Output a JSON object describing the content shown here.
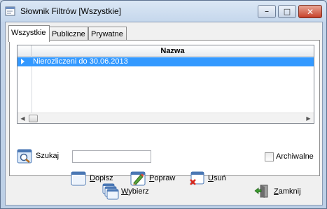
{
  "window": {
    "title": "Słownik Filtrów [Wszystkie]",
    "minimize_label": "–",
    "maximize_label": "□",
    "close_label": "✕"
  },
  "tabs": [
    {
      "label": "Wszystkie",
      "active": true
    },
    {
      "label": "Publiczne",
      "active": false
    },
    {
      "label": "Prywatne",
      "active": false
    }
  ],
  "grid": {
    "column_header": "Nazwa",
    "rows": [
      {
        "name": "Nierozliczeni do 30.06.2013",
        "selected": true
      }
    ],
    "scroll_left": "◀",
    "scroll_right": "▶"
  },
  "search": {
    "label": "Szukaj",
    "value": ""
  },
  "archive_checkbox": {
    "label": "Archiwalne",
    "checked": false
  },
  "actions": {
    "add_label_hotkey": "D",
    "add_label_rest": "opisz",
    "edit_label_hotkey": "P",
    "edit_label_rest": "opraw",
    "delete_label_hotkey": "U",
    "delete_label_rest": "suń"
  },
  "footer": {
    "select_label_hotkey": "W",
    "select_label_rest": "ybierz",
    "close_label_hotkey": "Z",
    "close_label_rest": "amknij"
  },
  "colors": {
    "selection": "#3399ff",
    "titlebar": "#c5d7ec"
  }
}
